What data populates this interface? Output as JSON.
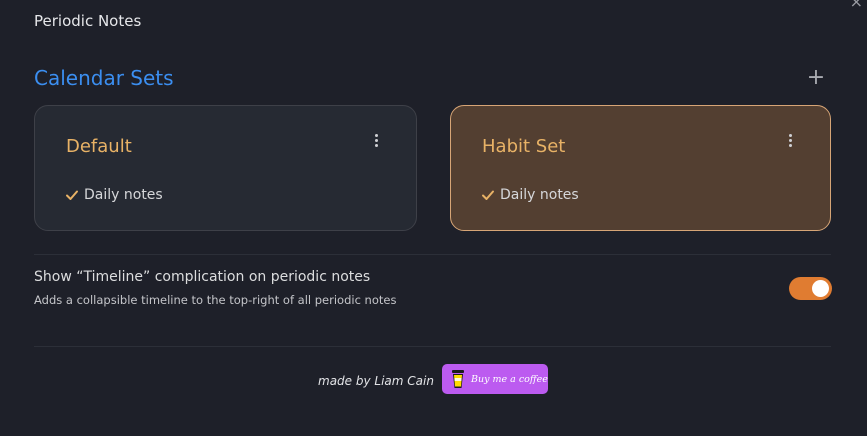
{
  "window": {
    "close_glyph": "×"
  },
  "plugin": {
    "title": "Periodic Notes"
  },
  "calendar_sets": {
    "heading": "Calendar Sets",
    "add_glyph": "+",
    "cards": [
      {
        "name": "Default",
        "feature": "Daily notes",
        "active": false
      },
      {
        "name": "Habit Set",
        "feature": "Daily notes",
        "active": true
      }
    ]
  },
  "timeline_setting": {
    "name": "Show “Timeline” complication on periodic notes",
    "description": "Adds a collapsible timeline to the top-right of all periodic notes",
    "enabled": true
  },
  "footer": {
    "made_by": "made by Liam Cain",
    "bmc_label": "Buy me a coffee"
  },
  "colors": {
    "accent": "#3b8ef0",
    "card_title": "#e8b266",
    "toggle_on": "#e07c31",
    "bmc_bg": "#bc5bf0",
    "active_card_bg": "#533f31",
    "active_card_border": "#d7a576"
  },
  "icons": {
    "close": "close-icon",
    "add": "plus-icon",
    "menu": "more-vertical-icon",
    "check": "check-icon",
    "coffee": "coffee-cup-icon"
  }
}
